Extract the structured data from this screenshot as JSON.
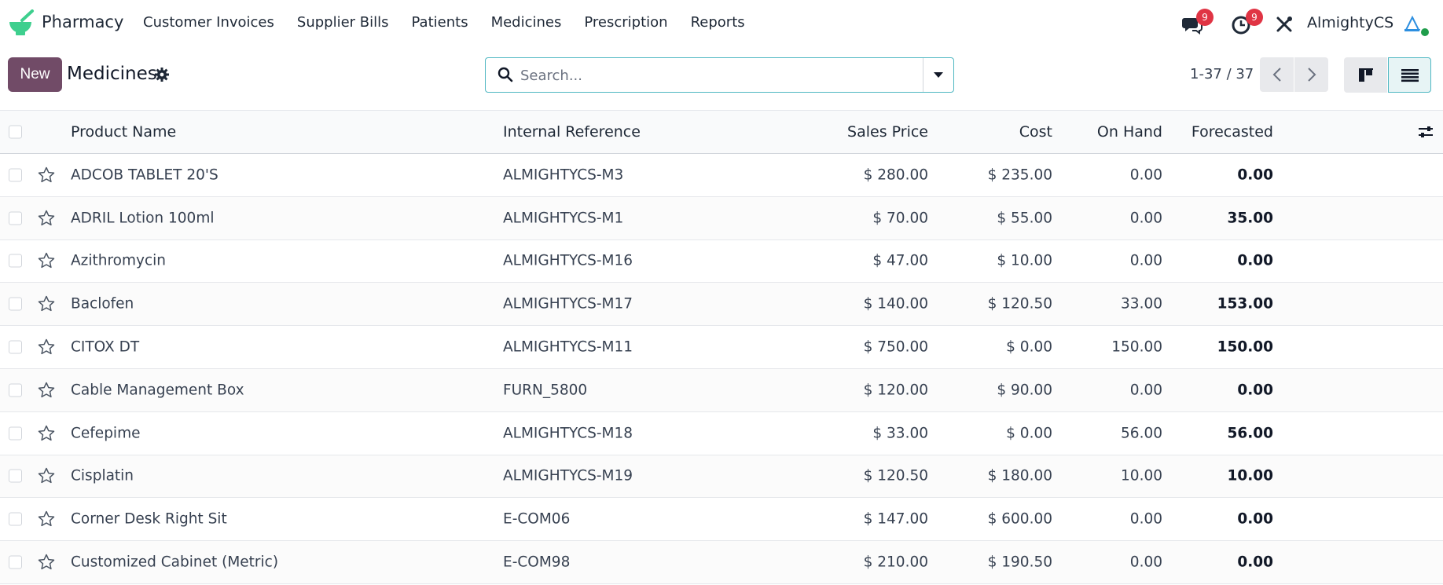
{
  "app": {
    "name": "Pharmacy"
  },
  "menu": [
    "Customer Invoices",
    "Supplier Bills",
    "Patients",
    "Medicines",
    "Prescription",
    "Reports"
  ],
  "systray": {
    "messages_count": "9",
    "activities_count": "9",
    "user_name": "AlmightyCS"
  },
  "control": {
    "new_label": "New",
    "title": "Medicines",
    "search_placeholder": "Search...",
    "pager": "1-37 / 37"
  },
  "table": {
    "headers": {
      "name": "Product Name",
      "ref": "Internal Reference",
      "sales": "Sales Price",
      "cost": "Cost",
      "on_hand": "On Hand",
      "forecasted": "Forecasted"
    },
    "rows": [
      {
        "name": "ADCOB TABLET 20'S",
        "ref": "ALMIGHTYCS-M3",
        "sales": "$ 280.00",
        "cost": "$ 235.00",
        "on_hand": "0.00",
        "forecasted": "0.00"
      },
      {
        "name": "ADRIL Lotion 100ml",
        "ref": "ALMIGHTYCS-M1",
        "sales": "$ 70.00",
        "cost": "$ 55.00",
        "on_hand": "0.00",
        "forecasted": "35.00"
      },
      {
        "name": "Azithromycin",
        "ref": "ALMIGHTYCS-M16",
        "sales": "$ 47.00",
        "cost": "$ 10.00",
        "on_hand": "0.00",
        "forecasted": "0.00"
      },
      {
        "name": "Baclofen",
        "ref": "ALMIGHTYCS-M17",
        "sales": "$ 140.00",
        "cost": "$ 120.50",
        "on_hand": "33.00",
        "forecasted": "153.00"
      },
      {
        "name": "CITOX DT",
        "ref": "ALMIGHTYCS-M11",
        "sales": "$ 750.00",
        "cost": "$ 0.00",
        "on_hand": "150.00",
        "forecasted": "150.00"
      },
      {
        "name": "Cable Management Box",
        "ref": "FURN_5800",
        "sales": "$ 120.00",
        "cost": "$ 90.00",
        "on_hand": "0.00",
        "forecasted": "0.00"
      },
      {
        "name": "Cefepime",
        "ref": "ALMIGHTYCS-M18",
        "sales": "$ 33.00",
        "cost": "$ 0.00",
        "on_hand": "56.00",
        "forecasted": "56.00"
      },
      {
        "name": "Cisplatin",
        "ref": "ALMIGHTYCS-M19",
        "sales": "$ 120.50",
        "cost": "$ 180.00",
        "on_hand": "10.00",
        "forecasted": "10.00"
      },
      {
        "name": "Corner Desk Right Sit",
        "ref": "E-COM06",
        "sales": "$ 147.00",
        "cost": "$ 600.00",
        "on_hand": "0.00",
        "forecasted": "0.00"
      },
      {
        "name": "Customized Cabinet (Metric)",
        "ref": "E-COM98",
        "sales": "$ 210.00",
        "cost": "$ 190.50",
        "on_hand": "0.00",
        "forecasted": "0.00"
      }
    ]
  },
  "colors": {
    "primary": "#714b67",
    "badge": "#e03444",
    "logo_green": "#3ecf8e",
    "search_border": "#4fb7c2",
    "online": "#1f9d4b"
  }
}
